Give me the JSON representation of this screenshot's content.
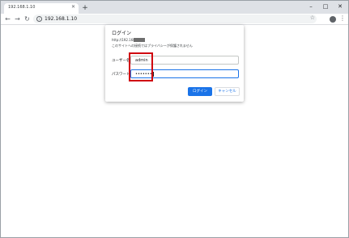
{
  "tab": {
    "title": "192.168.1.10",
    "close_icon": "close-icon"
  },
  "window_controls": {
    "minimize": "–",
    "maximize": "□",
    "close": "✕"
  },
  "toolbar": {
    "url": "192.168.1.10"
  },
  "dialog": {
    "title": "ログイン",
    "url_prefix": "http://192.168",
    "warning": "このサイトへの接続ではプライバシーが保護されません",
    "username_label": "ユーザー名",
    "username_value": "admin",
    "password_label": "パスワード",
    "password_value": "••••••••",
    "login_button": "ログイン",
    "cancel_button": "キャンセル"
  },
  "colors": {
    "accent": "#1a73e8",
    "highlight": "#d0000f"
  }
}
